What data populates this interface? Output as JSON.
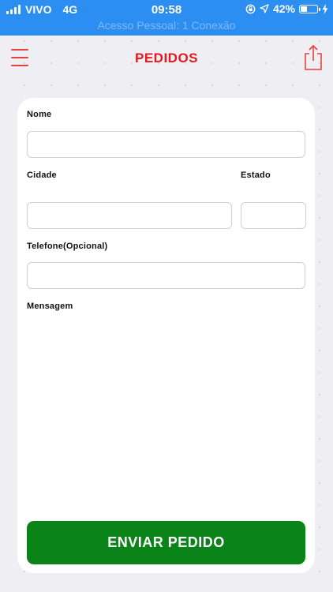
{
  "status_bar": {
    "carrier": "VIVO",
    "network": "4G",
    "time": "09:58",
    "battery_percent": "42%",
    "battery_level": 0.42,
    "subtitle": "Acesso Pessoal: 1 Conexão",
    "background_color": "#2d8ef2"
  },
  "header": {
    "title": "PEDIDOS",
    "title_color": "#e3191f",
    "menu_icon": "hamburger-menu-icon",
    "share_icon": "share-icon"
  },
  "form": {
    "name": {
      "label": "Nome",
      "value": ""
    },
    "city": {
      "label": "Cidade",
      "value": ""
    },
    "state": {
      "label": "Estado",
      "value": ""
    },
    "phone": {
      "label": "Telefone(Opcional)",
      "value": ""
    },
    "message": {
      "label": "Mensagem",
      "value": ""
    },
    "submit_label": "ENVIAR PEDIDO",
    "submit_color": "#0a8418"
  }
}
